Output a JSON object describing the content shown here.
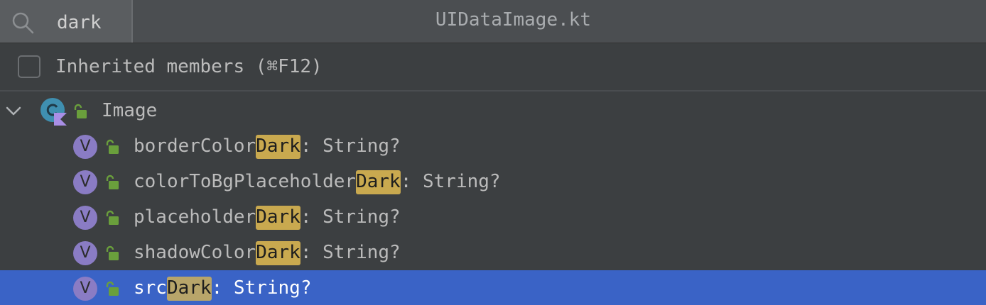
{
  "header": {
    "search_query": "dark",
    "file_title": "UIDataImage.kt"
  },
  "options": {
    "inherited_label": "Inherited members (⌘F12)",
    "inherited_checked": false
  },
  "tree": {
    "root": {
      "label": "Image",
      "expanded": true,
      "icon": "kotlin-class-icon"
    },
    "items": [
      {
        "prefix": "borderColor",
        "match": "Dark",
        "suffix": ": String?",
        "selected": false
      },
      {
        "prefix": "colorToBgPlaceholder",
        "match": "Dark",
        "suffix": ": String?",
        "selected": false
      },
      {
        "prefix": "placeholder",
        "match": "Dark",
        "suffix": ": String?",
        "selected": false
      },
      {
        "prefix": "shadowColor",
        "match": "Dark",
        "suffix": ": String?",
        "selected": false
      },
      {
        "prefix": "src",
        "match": "Dark",
        "suffix": ": String?",
        "selected": true
      }
    ],
    "variable_icon_letter": "V"
  },
  "colors": {
    "background": "#3c3f41",
    "header": "#4b4e51",
    "selection": "#3a63c6",
    "match_highlight": "#c9a94f",
    "variable_icon": "#8a7cc4",
    "lock_green": "#6a9f3c"
  }
}
